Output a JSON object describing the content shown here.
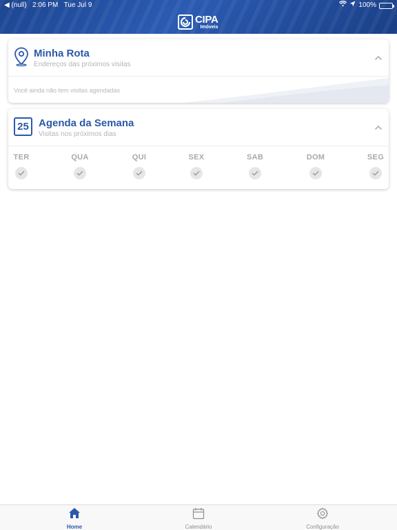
{
  "status_bar": {
    "back_label": "◀ (null)",
    "time": "2:06 PM",
    "date": "Tue Jul 9",
    "battery": "100%",
    "battery_level": 1.0
  },
  "header": {
    "brand": "CIPA",
    "brand_sub": "Imóveis",
    "colors": {
      "primary": "#1d4591",
      "accent": "#2a59a8"
    }
  },
  "minha_rota": {
    "title": "Minha Rota",
    "subtitle": "Endereços das próximos visitas",
    "empty_message": "Você ainda não tem visitas agendadas",
    "icon": "map-pin-icon"
  },
  "agenda": {
    "title": "Agenda da Semana",
    "subtitle": "Visitas nos próximos dias",
    "calendar_day": "25",
    "days": [
      "TER",
      "QUA",
      "QUI",
      "SEX",
      "SAB",
      "DOM",
      "SEG"
    ]
  },
  "tabbar": {
    "tabs": [
      {
        "label": "Home",
        "icon": "home-icon",
        "active": true
      },
      {
        "label": "Calendário",
        "icon": "calendar-icon",
        "active": false
      },
      {
        "label": "Configuração",
        "icon": "gear-icon",
        "active": false
      }
    ]
  }
}
